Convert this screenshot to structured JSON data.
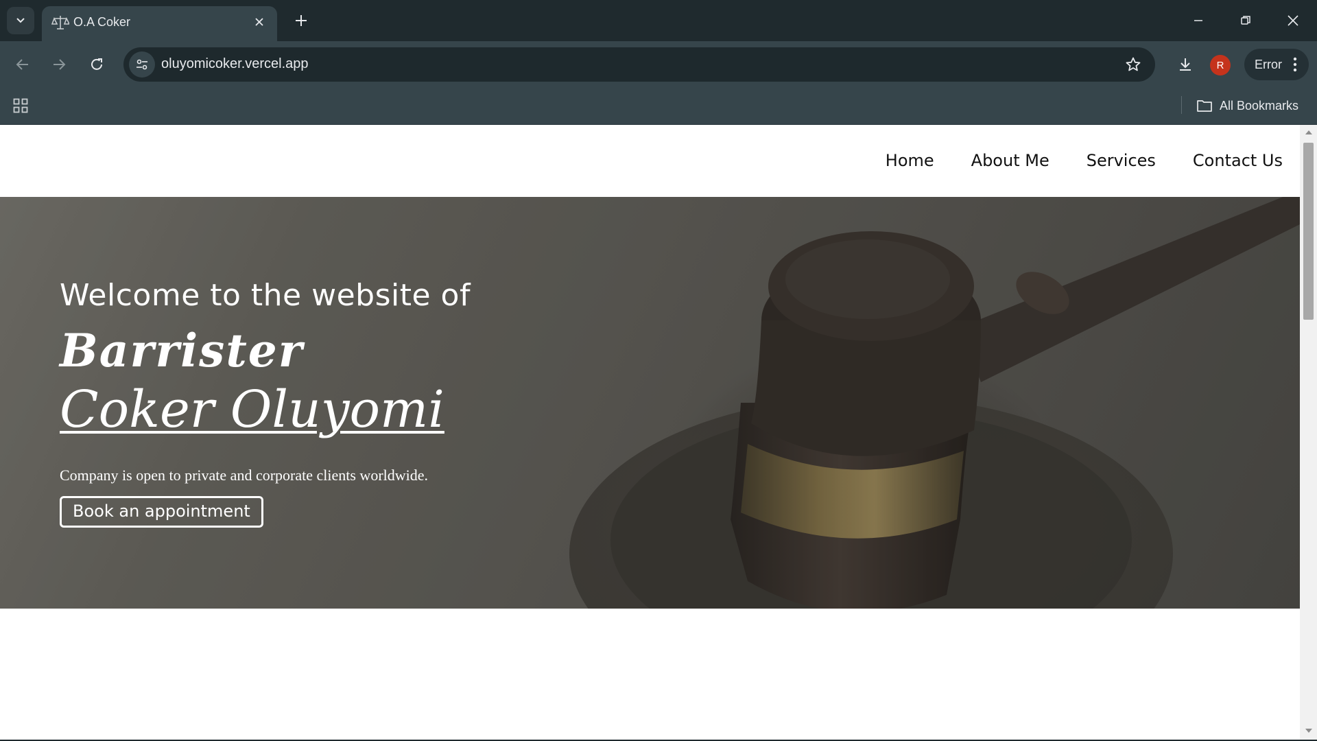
{
  "browser": {
    "tab": {
      "title": "O.A Coker",
      "favicon": "scales-of-justice-icon"
    },
    "address_bar": {
      "url": "oluyomicoker.vercel.app"
    },
    "profile": {
      "initial": "R",
      "color": "#c5331c"
    },
    "status_chip": {
      "label": "Error"
    },
    "bookmarks_bar": {
      "all_bookmarks_label": "All Bookmarks"
    }
  },
  "site": {
    "nav": {
      "items": [
        {
          "label": "Home"
        },
        {
          "label": "About Me"
        },
        {
          "label": "Services"
        },
        {
          "label": "Contact Us"
        }
      ]
    },
    "hero": {
      "welcome": "Welcome to the website of",
      "title_line1": "Barrister",
      "title_line2": "Coker Oluyomi",
      "tagline": "Company is open to private and corporate clients worldwide.",
      "cta_label": "Book an appointment",
      "background": "gavel-photo"
    }
  },
  "colors": {
    "chrome_dark": "#1f2a2e",
    "chrome_toolbar": "#36454b",
    "hero_overlay": "#4f4d48"
  }
}
